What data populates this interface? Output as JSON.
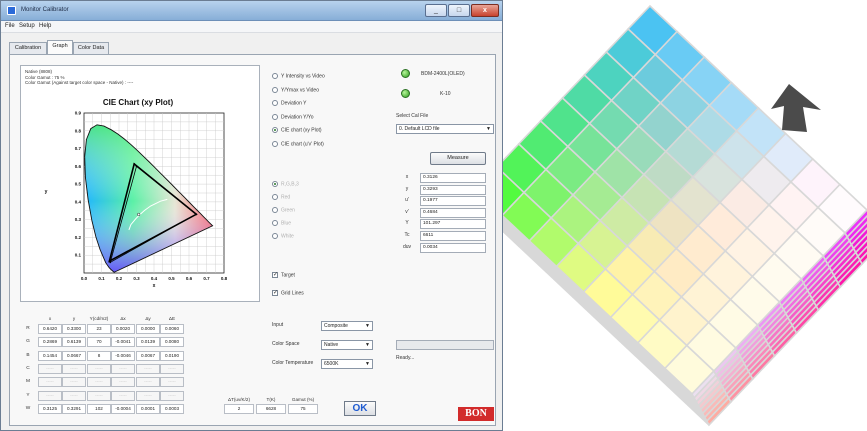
{
  "window": {
    "title": "Monitor Calibrator",
    "controls": {
      "minimize": "_",
      "maximize": "□",
      "close": "x"
    }
  },
  "menu": [
    "File",
    "Setup",
    "Help"
  ],
  "tabs": [
    {
      "label": "Calibration",
      "active": false
    },
    {
      "label": "Graph",
      "active": true
    },
    {
      "label": "Color Data",
      "active": false
    }
  ],
  "info": {
    "line1": "Native (8808)",
    "line2": "Color Gamut : 75 %",
    "line3": "Color Gamut (Against target color space - Native) : ----"
  },
  "chart_data": {
    "type": "scatter",
    "title": "CIE Chart (xy Plot)",
    "xlabel": "x",
    "ylabel": "y",
    "xlim": [
      0.0,
      0.8
    ],
    "ylim": [
      0.0,
      0.9
    ],
    "x_ticks": [
      "0.0",
      "0.1",
      "0.2",
      "0.3",
      "0.4",
      "0.5",
      "0.6",
      "0.7",
      "0.8"
    ],
    "y_ticks": [
      "0.1",
      "0.2",
      "0.3",
      "0.4",
      "0.5",
      "0.6",
      "0.7",
      "0.8",
      "0.9"
    ],
    "grid": true,
    "spectral_locus": [
      [
        0.1741,
        0.005
      ],
      [
        0.1738,
        0.0049
      ],
      [
        0.1733,
        0.0048
      ],
      [
        0.1726,
        0.0048
      ],
      [
        0.1714,
        0.0051
      ],
      [
        0.1689,
        0.0069
      ],
      [
        0.1644,
        0.0109
      ],
      [
        0.1566,
        0.0177
      ],
      [
        0.144,
        0.0297
      ],
      [
        0.1241,
        0.0578
      ],
      [
        0.0913,
        0.1327
      ],
      [
        0.0687,
        0.2007
      ],
      [
        0.0454,
        0.295
      ],
      [
        0.0235,
        0.4127
      ],
      [
        0.0082,
        0.5384
      ],
      [
        0.0039,
        0.6548
      ],
      [
        0.0139,
        0.7502
      ],
      [
        0.0389,
        0.812
      ],
      [
        0.0743,
        0.8338
      ],
      [
        0.1142,
        0.8262
      ],
      [
        0.1547,
        0.8059
      ],
      [
        0.1929,
        0.7816
      ],
      [
        0.2296,
        0.7543
      ],
      [
        0.2658,
        0.7243
      ],
      [
        0.3016,
        0.6923
      ],
      [
        0.3373,
        0.6589
      ],
      [
        0.3731,
        0.6245
      ],
      [
        0.4087,
        0.5896
      ],
      [
        0.4441,
        0.5547
      ],
      [
        0.4788,
        0.5202
      ],
      [
        0.5125,
        0.4866
      ],
      [
        0.5448,
        0.4544
      ],
      [
        0.5752,
        0.4242
      ],
      [
        0.6029,
        0.3965
      ],
      [
        0.627,
        0.3725
      ],
      [
        0.6482,
        0.3514
      ],
      [
        0.6658,
        0.334
      ],
      [
        0.6801,
        0.3197
      ],
      [
        0.6915,
        0.3083
      ],
      [
        0.7006,
        0.2993
      ],
      [
        0.714,
        0.2859
      ],
      [
        0.7347,
        0.2653
      ]
    ],
    "series": [
      {
        "kind": "measured-gamut",
        "points": [
          [
            0.642,
            0.33
          ],
          [
            0.2869,
            0.6139
          ],
          [
            0.1454,
            0.0667
          ]
        ]
      },
      {
        "kind": "target-gamut",
        "points": [
          [
            0.64,
            0.33
          ],
          [
            0.3,
            0.6
          ],
          [
            0.15,
            0.06
          ]
        ]
      },
      {
        "kind": "white-point",
        "points": [
          [
            0.3126,
            0.3291
          ]
        ]
      }
    ],
    "planckian_locus": [
      [
        0.2565,
        0.2425
      ],
      [
        0.268,
        0.272
      ],
      [
        0.281,
        0.288
      ],
      [
        0.2952,
        0.305
      ],
      [
        0.3135,
        0.3237
      ],
      [
        0.345,
        0.3516
      ],
      [
        0.3805,
        0.3768
      ],
      [
        0.4369,
        0.4041
      ],
      [
        0.476,
        0.414
      ]
    ]
  },
  "radios": [
    {
      "label": "Y Intensity vs Video",
      "checked": false,
      "disabled": false
    },
    {
      "label": "Y/Ymax vs Video",
      "checked": false,
      "disabled": false
    },
    {
      "label": "Deviation Y",
      "checked": false,
      "disabled": false
    },
    {
      "label": "Deviation Y/Yo",
      "checked": false,
      "disabled": false
    },
    {
      "label": "CIE chart (xy Plot)",
      "checked": true,
      "disabled": false
    },
    {
      "label": "CIE chart (u'v' Plot)",
      "checked": false,
      "disabled": false
    }
  ],
  "channel_radios": [
    {
      "label": "R,G,B,3",
      "checked": true
    },
    {
      "label": "Red",
      "checked": false
    },
    {
      "label": "Green",
      "checked": false
    },
    {
      "label": "Blue",
      "checked": false
    },
    {
      "label": "White",
      "checked": false
    }
  ],
  "checkboxes": [
    {
      "label": "Target",
      "checked": true
    },
    {
      "label": "Grid Lines",
      "checked": true
    }
  ],
  "status": {
    "device1": "BDM-2400L(OLED)",
    "device2": "K-10",
    "cal_file_label": "Select Cal File",
    "cal_file_value": "0. Default LCD file",
    "measure_button": "Measure"
  },
  "measurements": [
    {
      "label": "x",
      "value": "0.3126"
    },
    {
      "label": "y",
      "value": "0.3293"
    },
    {
      "label": "u'",
      "value": "0.1977"
    },
    {
      "label": "v'",
      "value": "0.4684"
    },
    {
      "label": "Y",
      "value": "101.297"
    },
    {
      "label": "Tc",
      "value": "6611"
    },
    {
      "label": "duv",
      "value": "0.0034"
    }
  ],
  "progress": 0.0,
  "status_text": "Ready...",
  "table": {
    "headers": [
      "x",
      "y",
      "Y(cd/m2)",
      "Δx",
      "Δy",
      "ΔE"
    ],
    "rows": [
      {
        "label": "R",
        "cells": [
          "0.6420",
          "0.3300",
          "23",
          "0.0020",
          "0.0000",
          "0.0060"
        ]
      },
      {
        "label": "G",
        "cells": [
          "0.2869",
          "0.6139",
          "70",
          "-0.0041",
          "0.0139",
          "0.0080"
        ]
      },
      {
        "label": "B",
        "cells": [
          "0.1454",
          "0.0667",
          "8",
          "-0.0046",
          "0.0067",
          "0.0190"
        ]
      },
      {
        "label": "C",
        "cells": [
          "-----",
          "-----",
          "-----",
          "-----",
          "-----",
          "-----"
        ]
      },
      {
        "label": "M",
        "cells": [
          "-----",
          "-----",
          "-----",
          "-----",
          "-----",
          "-----"
        ]
      },
      {
        "label": "Y",
        "cells": [
          "-----",
          "-----",
          "-----",
          "-----",
          "-----",
          "-----"
        ]
      },
      {
        "label": "W",
        "cells": [
          "0.3125",
          "0.3291",
          "102",
          "-0.0004",
          "0.0001",
          "0.0003"
        ]
      }
    ],
    "extra_headers": [
      "ΔT(uv/K/2)",
      "T(K)",
      "Gamut (%)"
    ],
    "extra_values": [
      "2",
      "6628",
      "75"
    ]
  },
  "settings": [
    {
      "label": "Input",
      "value": "Composite"
    },
    {
      "label": "Color Space",
      "value": "Native"
    },
    {
      "label": "Color Temperature",
      "value": "6500K"
    }
  ],
  "ok_button": "OK",
  "logo_text": "BON"
}
